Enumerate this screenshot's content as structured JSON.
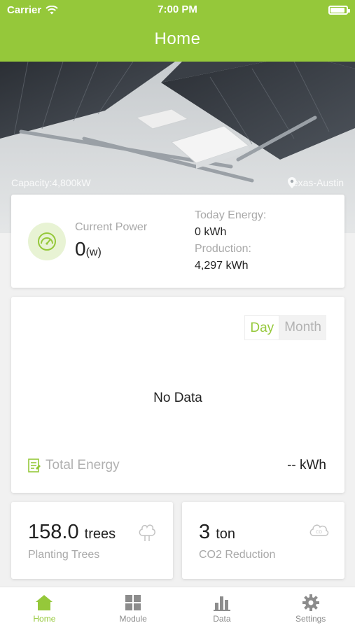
{
  "status_bar": {
    "carrier": "Carrier",
    "time": "7:00 PM"
  },
  "header": {
    "title": "Home"
  },
  "banner": {
    "capacity": "Capacity:4,800kW",
    "location": "Texas-Austin"
  },
  "power": {
    "current_label": "Current Power",
    "current_value": "0",
    "current_unit": "(w)",
    "today_label": "Today Energy:",
    "today_value": "0 kWh",
    "production_label": "Production:",
    "production_value": "4,297 kWh"
  },
  "chart": {
    "toggle": {
      "day": "Day",
      "month": "Month",
      "selected": "Day"
    },
    "empty_text": "No Data",
    "total_label": "Total Energy",
    "total_value": "-- kWh"
  },
  "trees": {
    "value": "158.0",
    "unit": "trees",
    "label": "Planting Trees"
  },
  "co2": {
    "value": "3",
    "unit": "ton",
    "label": "CO2 Reduction"
  },
  "tabs": [
    {
      "label": "Home",
      "icon": "home-icon",
      "active": true
    },
    {
      "label": "Module",
      "icon": "grid-icon",
      "active": false
    },
    {
      "label": "Data",
      "icon": "bar-chart-icon",
      "active": false
    },
    {
      "label": "Settings",
      "icon": "gear-icon",
      "active": false
    }
  ],
  "colors": {
    "accent": "#95c83a",
    "background": "#f1f1f1",
    "muted": "#a8a8a8"
  }
}
